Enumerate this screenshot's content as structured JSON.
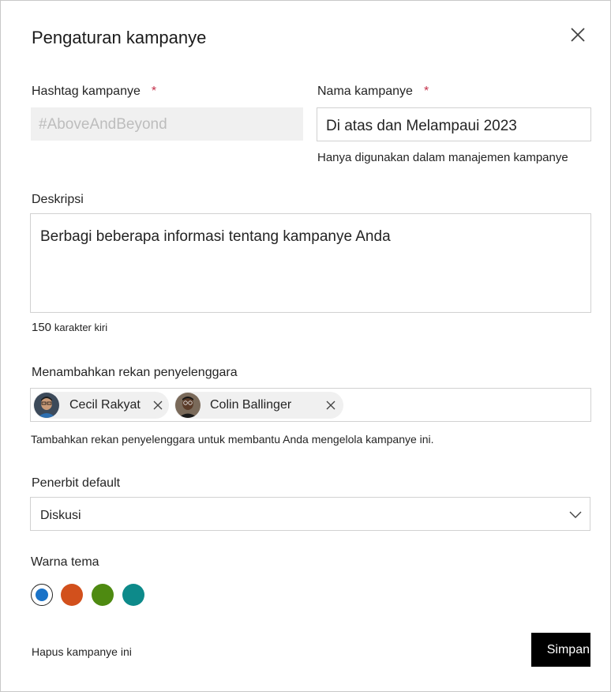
{
  "dialog": {
    "title": "Pengaturan kampanye"
  },
  "hashtag": {
    "label": "Hashtag kampanye",
    "required_mark": "*",
    "value": "#AboveAndBeyond"
  },
  "campaign_name": {
    "label": "Nama kampanye",
    "required_mark": "*",
    "value": "Di atas dan Melampaui 2023",
    "helper": "Hanya digunakan dalam manajemen kampanye"
  },
  "description": {
    "label": "Deskripsi",
    "value": "Berbagi beberapa informasi tentang kampanye Anda",
    "count": "150",
    "count_suffix": "karakter kiri"
  },
  "co_organizers": {
    "label": "Menambahkan rekan penyelenggara",
    "people": [
      {
        "name": "Cecil  Rakyat"
      },
      {
        "name": "Colin Ballinger"
      }
    ],
    "helper": "Tambahkan rekan penyelenggara untuk membantu Anda mengelola kampanye ini."
  },
  "default_publisher": {
    "label": "Penerbit default",
    "selected": "Diskusi"
  },
  "theme": {
    "label": "Warna tema",
    "colors": [
      "#1a73c8",
      "#d2501c",
      "#4e8a11",
      "#0d8a8a"
    ],
    "selected_index": 0
  },
  "footer": {
    "delete_label": "Hapus kampanye ini",
    "save_label": "Simpan"
  },
  "icons": {
    "close": "close-icon",
    "remove": "remove-icon",
    "dropdown": "chevron-down-icon"
  }
}
